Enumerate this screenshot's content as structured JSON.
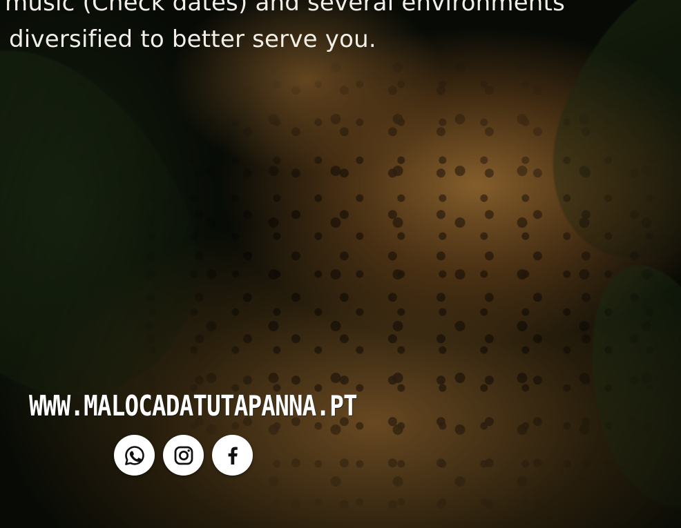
{
  "intro": {
    "line1": "music (Check dates) and several environments",
    "line2": "diversified to better serve you."
  },
  "footer": {
    "website": "WWW.MALOCADATUTAPANNA.PT"
  },
  "social": {
    "links": [
      {
        "icon": "whatsapp-icon"
      },
      {
        "icon": "instagram-icon"
      },
      {
        "icon": "facebook-icon"
      }
    ]
  },
  "colors": {
    "text": "#f2efe8",
    "icon_bg": "#ffffff",
    "icon_fg": "#111111"
  }
}
